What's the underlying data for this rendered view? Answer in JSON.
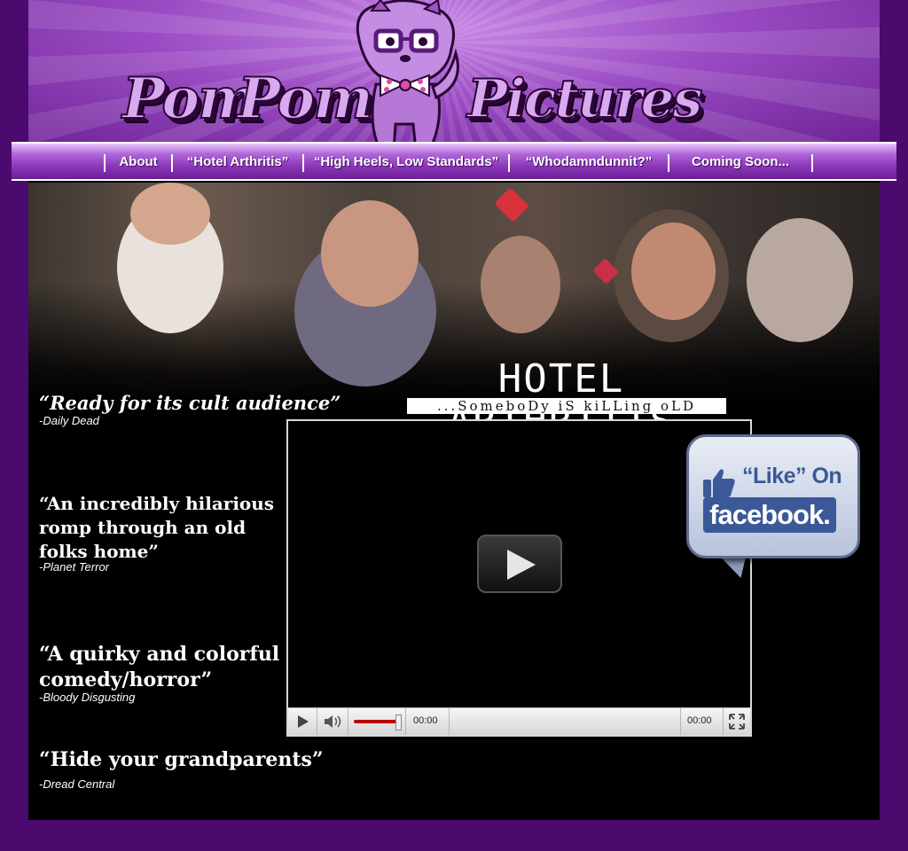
{
  "brand": {
    "word1": "Pom",
    "word2": "Pom",
    "word3": "Pictures",
    "accent_color": "#8a36b8",
    "background_color": "#4b0a6e"
  },
  "nav": {
    "items": [
      {
        "label": "About"
      },
      {
        "label": "“Hotel Arthritis”"
      },
      {
        "label": "“High Heels, Low Standards”"
      },
      {
        "label": "“Whodamndunnit?”"
      },
      {
        "label": "Coming Soon..."
      }
    ]
  },
  "movie": {
    "title": "HOTEL ARTHRITIS",
    "tagline": "...SomeboDy iS kiLLing oLD people"
  },
  "quotes": [
    {
      "text": "“Ready for its cult audience”",
      "source": "-Daily Dead"
    },
    {
      "text": "“An incredibly hilarious romp through an old folks  home”",
      "source": "-Planet Terror"
    },
    {
      "text": "“A quirky and colorful comedy/horror”",
      "source": "-Bloody Disgusting"
    },
    {
      "text": "“Hide your grandparents”",
      "source": "-Dread Central"
    }
  ],
  "player": {
    "current_time": "00:00",
    "duration": "00:00",
    "volume_level": 0.9,
    "play_icon": "play-icon",
    "volume_icon": "volume-icon",
    "fullscreen_icon": "fullscreen-icon"
  },
  "facebook": {
    "like_text": "“Like” On",
    "brand_text": "facebook.",
    "icon": "thumbs-up-icon"
  }
}
